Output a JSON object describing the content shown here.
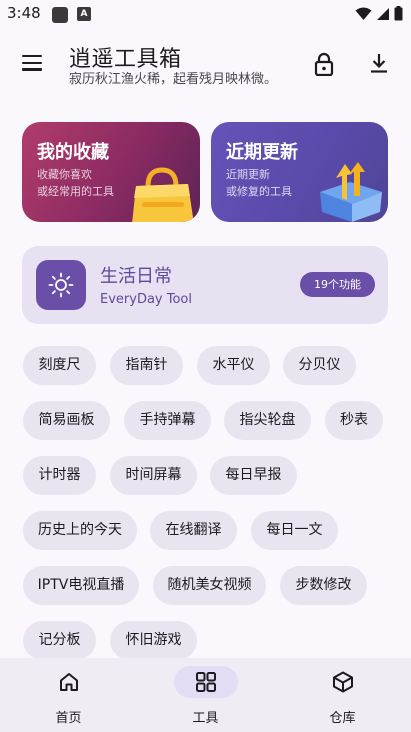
{
  "status_bar": {
    "time": "3:48",
    "app_icons": [
      "notification-app-icon",
      "font-app-icon"
    ],
    "indicators": [
      "wifi-icon",
      "signal-icon",
      "battery-icon"
    ]
  },
  "app_bar": {
    "title": "逍遥工具箱",
    "subtitle": "寂历秋江渔火稀，起看残月映林微。",
    "icons": [
      "menu-icon",
      "lock-icon",
      "download-icon"
    ]
  },
  "cards": {
    "favorites": {
      "title": "我的收藏",
      "desc1": "收藏你喜欢",
      "desc2": "或经常用的工具",
      "color": "#9b3365"
    },
    "updates": {
      "title": "近期更新",
      "desc1": "近期更新",
      "desc2": "或修复的工具",
      "color": "#5b4bac"
    }
  },
  "daily": {
    "title": "生活日常",
    "subtitle": "EveryDay Tool",
    "badge": "19个功能",
    "accent": "#6a4fa8"
  },
  "tools": [
    "刻度尺",
    "指南针",
    "水平仪",
    "分贝仪",
    "简易画板",
    "手持弹幕",
    "指尖轮盘",
    "秒表",
    "计时器",
    "时间屏幕",
    "每日早报",
    "历史上的今天",
    "在线翻译",
    "每日一文",
    "IPTV电视直播",
    "随机美女视频",
    "步数修改",
    "记分板",
    "怀旧游戏"
  ],
  "bottom_nav": {
    "items": [
      {
        "label": "首页",
        "icon": "home-icon",
        "active": false
      },
      {
        "label": "工具",
        "icon": "grid-icon",
        "active": true
      },
      {
        "label": "仓库",
        "icon": "box-icon",
        "active": false
      }
    ]
  }
}
